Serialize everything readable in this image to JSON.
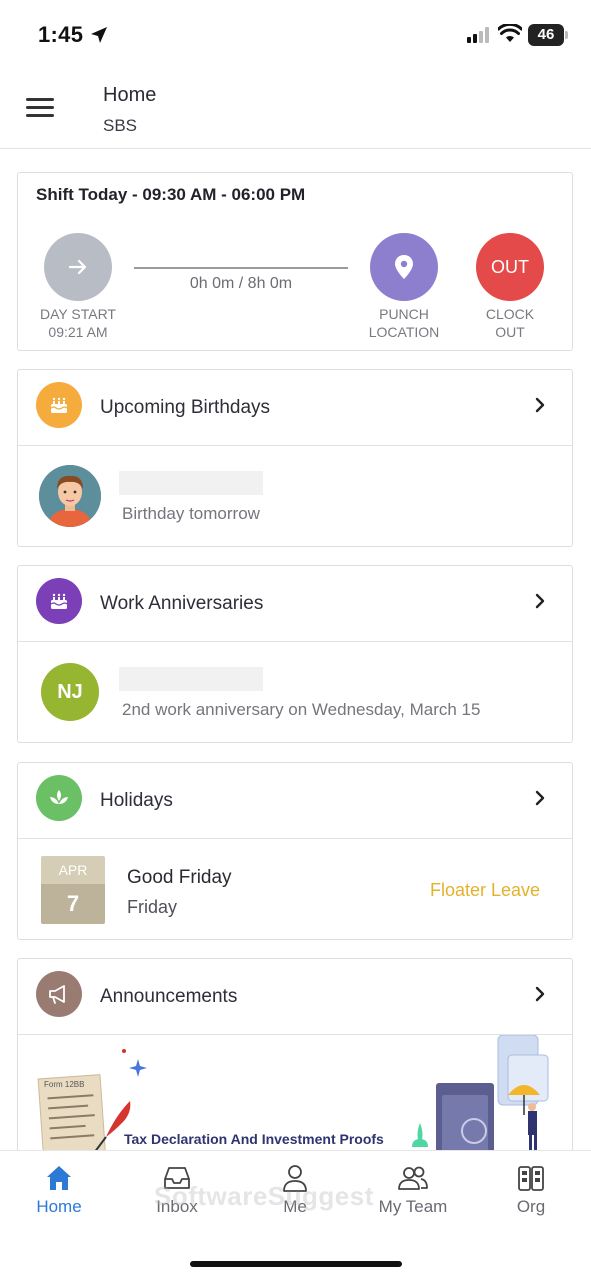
{
  "status_bar": {
    "time": "1:45",
    "battery": "46"
  },
  "header": {
    "title": "Home",
    "subtitle": "SBS"
  },
  "shift": {
    "title": "Shift Today - 09:30 AM - 06:00 PM",
    "progress": "0h 0m / 8h 0m",
    "day_start_label": "DAY START",
    "day_start_time": "09:21 AM",
    "punch_label_1": "PUNCH",
    "punch_label_2": "LOCATION",
    "out_button": "OUT",
    "clock_label_1": "CLOCK",
    "clock_label_2": "OUT"
  },
  "birthdays": {
    "title": "Upcoming Birthdays",
    "entry_text": "Birthday tomorrow"
  },
  "anniversaries": {
    "title": "Work Anniversaries",
    "initials": "NJ",
    "entry_text": "2nd work anniversary on Wednesday, March 15"
  },
  "holidays": {
    "title": "Holidays",
    "month": "APR",
    "day": "7",
    "name": "Good Friday",
    "weekday": "Friday",
    "type": "Floater Leave"
  },
  "announcements": {
    "title": "Announcements",
    "form_label": "Form 12BB",
    "banner_text": "Tax Declaration And Investment Proofs"
  },
  "nav": {
    "items": [
      {
        "label": "Home",
        "icon": "home-icon",
        "active": true
      },
      {
        "label": "Inbox",
        "icon": "inbox-icon",
        "active": false
      },
      {
        "label": "Me",
        "icon": "person-icon",
        "active": false
      },
      {
        "label": "My Team",
        "icon": "team-icon",
        "active": false
      },
      {
        "label": "Org",
        "icon": "org-icon",
        "active": false
      }
    ],
    "watermark": "SoftwareSuggest"
  },
  "colors": {
    "accent": "#2c79d6",
    "out_red": "#e44a4a",
    "punch_purple": "#8d7fce",
    "floater": "#e6b12a"
  }
}
